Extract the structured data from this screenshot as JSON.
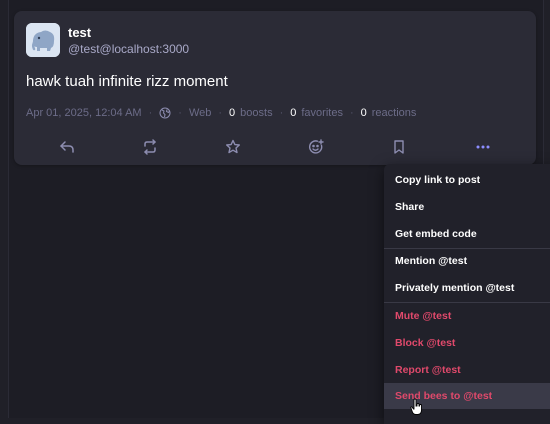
{
  "status": {
    "display_name": "test",
    "acct": "@test@localhost:3000",
    "content": "hawk tuah infinite rizz moment",
    "timestamp": "Apr 01, 2025, 12:04 AM",
    "visibility_icon": "globe-icon",
    "application": "Web",
    "boosts_count": "0",
    "boosts_label": "boosts",
    "favorites_count": "0",
    "favorites_label": "favorites",
    "reactions_count": "0",
    "reactions_label": "reactions"
  },
  "actions": [
    "reply-icon",
    "boost-icon",
    "favorite-icon",
    "emoji-reaction-icon",
    "bookmark-icon",
    "more-icon"
  ],
  "menu": {
    "copy_link": "Copy link to post",
    "share": "Share",
    "embed": "Get embed code",
    "mention": "Mention @test",
    "direct": "Privately mention @test",
    "mute": "Mute @test",
    "block": "Block @test",
    "report": "Report @test",
    "bees": "Send bees to @test"
  },
  "colors": {
    "background": "#1d1d25",
    "card": "#2b2b36",
    "accent": "#8c8dff",
    "danger": "#e0496b",
    "icon": "#8d8db0"
  }
}
